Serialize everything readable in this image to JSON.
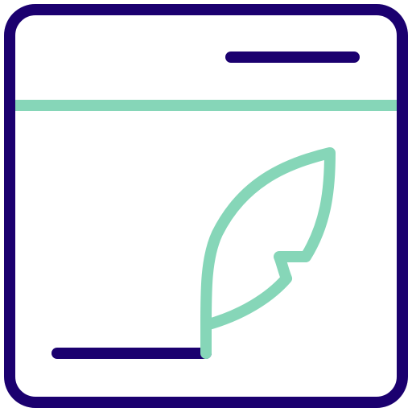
{
  "icon": {
    "semantic": "web-page-quill-signature-icon",
    "colors": {
      "outline": "#1b006f",
      "accent": "#86d6b8"
    }
  }
}
